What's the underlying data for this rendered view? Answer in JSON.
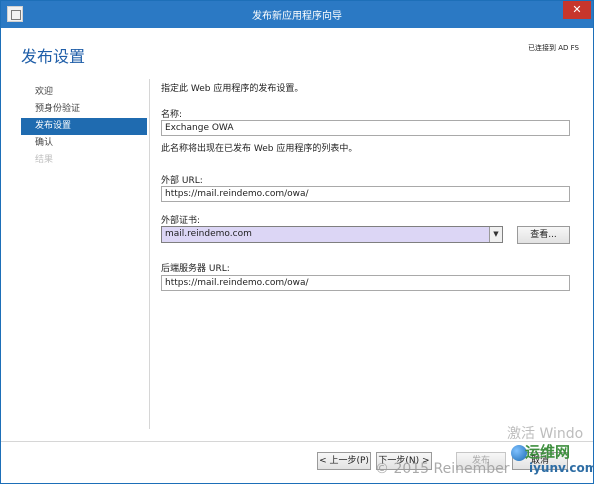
{
  "window": {
    "title": "发布新应用程序向导",
    "close_glyph": "✕"
  },
  "header": {
    "title": "发布设置",
    "server": "已连接到 AD FS"
  },
  "steps": [
    {
      "label": "欢迎",
      "state": "normal"
    },
    {
      "label": "预身份验证",
      "state": "normal"
    },
    {
      "label": "发布设置",
      "state": "active"
    },
    {
      "label": "确认",
      "state": "normal"
    },
    {
      "label": "结果",
      "state": "disabled"
    }
  ],
  "form": {
    "intro": "指定此 Web 应用程序的发布设置。",
    "name_label": "名称:",
    "name_value": "Exchange OWA",
    "name_note": "此名称将出现在已发布 Web 应用程序的列表中。",
    "external_url_label": "外部 URL:",
    "external_url_value": "https://mail.reindemo.com/owa/",
    "cert_label": "外部证书:",
    "cert_value": "mail.reindemo.com",
    "cert_arrow": "▼",
    "view_button": "查看...",
    "backend_label": "后端服务器 URL:",
    "backend_value": "https://mail.reindemo.com/owa/"
  },
  "footer": {
    "prev": "< 上一步(P)",
    "next": "下一步(N) >",
    "publish": "发布",
    "cancel": "取消"
  },
  "overlay": {
    "activate": "激活 Windo",
    "copyright": "© 2015 Reinember",
    "logo_cn": "运维网",
    "logo_en": "iyunv.com"
  },
  "colors": {
    "titlebar": "#2b79c4",
    "accent": "#1f6bb0",
    "combo_selected": "#dcd6f5"
  }
}
